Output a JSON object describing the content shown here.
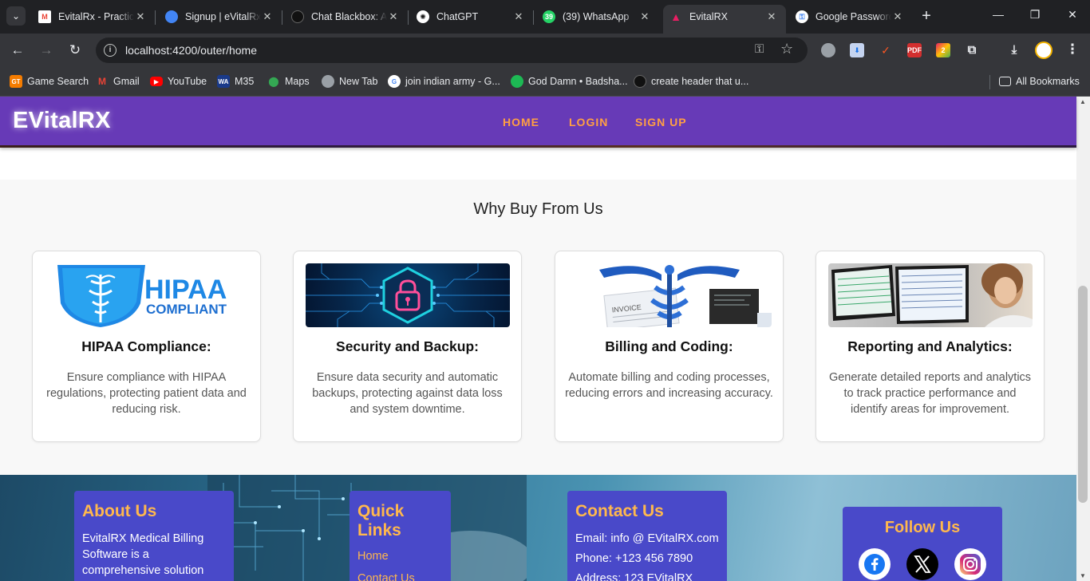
{
  "browser": {
    "tabs": [
      {
        "title": "EvitalRx - Practic",
        "favicon": "gmail-icon",
        "color": "#ea4335"
      },
      {
        "title": "Signup | eVitalRx",
        "favicon": "evitalrx-icon",
        "color": "#4285f4"
      },
      {
        "title": "Chat Blackbox: A",
        "favicon": "blackbox-icon",
        "color": "#111111"
      },
      {
        "title": "ChatGPT",
        "favicon": "chatgpt-icon",
        "color": "#ffffff"
      },
      {
        "title": "(39) WhatsApp",
        "favicon": "whatsapp-icon",
        "color": "#25d366",
        "badge": "39"
      },
      {
        "title": "EvitalRX",
        "favicon": "angular-icon",
        "color": "#c3002f",
        "active": true
      },
      {
        "title": "Google Password",
        "favicon": "google-password-icon",
        "color": "#4285f4"
      }
    ],
    "url": "localhost:4200/outer/home",
    "bookmarks": [
      {
        "label": "Game Search",
        "icon": "gt-icon",
        "color": "#f57c00"
      },
      {
        "label": "Gmail",
        "icon": "gmail-icon",
        "color": "#ea4335"
      },
      {
        "label": "YouTube",
        "icon": "youtube-icon",
        "color": "#ff0000"
      },
      {
        "label": "M35",
        "icon": "wa-icon",
        "color": "#1a3a8a"
      },
      {
        "label": "Maps",
        "icon": "maps-icon",
        "color": "#34a853"
      },
      {
        "label": "New Tab",
        "icon": "globe-icon",
        "color": "#9aa0a6"
      },
      {
        "label": "join indian army - G...",
        "icon": "google-icon",
        "color": "#4285f4"
      },
      {
        "label": "God Damn • Badsha...",
        "icon": "spotify-icon",
        "color": "#1db954"
      },
      {
        "label": "create header that u...",
        "icon": "blackbox-icon",
        "color": "#111111"
      }
    ],
    "all_bookmarks": "All Bookmarks"
  },
  "site": {
    "logo": "EVitalRX",
    "nav": [
      "HOME",
      "LOGIN",
      "SIGN UP"
    ],
    "accent": "#ff9f43",
    "header_color": "#673ab7"
  },
  "why": {
    "title": "Why Buy From Us",
    "cards": [
      {
        "title": "HIPAA Compliance:",
        "text": "Ensure compliance with HIPAA regulations, protecting patient data and reducing risk.",
        "image": "hipaa-compliant-logo",
        "image_text": [
          "HIPAA",
          "COMPLIANT"
        ]
      },
      {
        "title": "Security and Backup:",
        "text": "Ensure data security and automatic backups, protecting against data loss and system downtime.",
        "image": "padlock-circuit-image"
      },
      {
        "title": "Billing and Coding:",
        "text": "Automate billing and coding processes, reducing errors and increasing accuracy.",
        "image": "caduceus-invoice-image",
        "image_text": [
          "INVOICE"
        ]
      },
      {
        "title": "Reporting and Analytics:",
        "text": "Generate detailed reports and analytics to track practice performance and identify areas for improvement.",
        "image": "analytics-monitors-image"
      }
    ]
  },
  "footer": {
    "about": {
      "title": "About Us",
      "lines": [
        "EvitalRX Medical Billing",
        "Software is a",
        "comprehensive solution"
      ]
    },
    "quick_links": {
      "title": "Quick Links",
      "links": [
        "Home",
        "Contact Us"
      ]
    },
    "contact": {
      "title": "Contact Us",
      "lines": [
        "Email: info @ EVitalRX.com",
        "Phone: +123 456 7890",
        "Address: 123 EVitalRX"
      ]
    },
    "follow": {
      "title": "Follow Us",
      "icons": [
        "facebook-icon",
        "x-twitter-icon",
        "instagram-icon"
      ]
    }
  }
}
